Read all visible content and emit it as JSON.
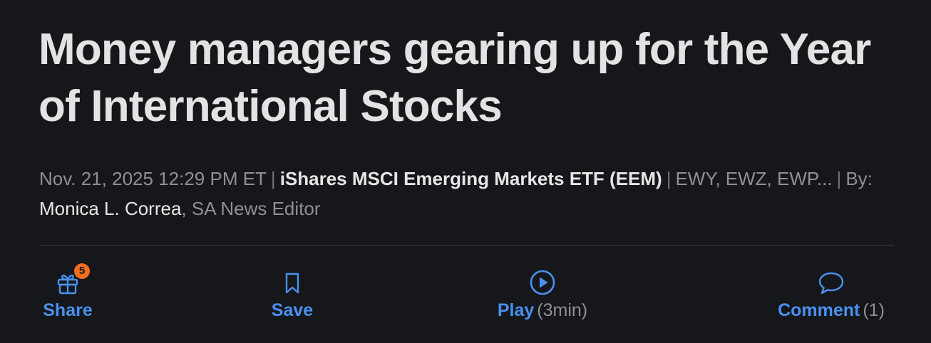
{
  "article": {
    "headline": "Money managers gearing up for the Year of International Stocks",
    "date": "Nov. 21, 2025 12:29 PM ET",
    "primary_ticker": "iShares MSCI Emerging Markets ETF (EEM)",
    "other_tickers": "EWY, EWZ, EWP...",
    "by_label": "By:",
    "author": "Monica L. Correa",
    "author_role": ", SA News Editor",
    "separator": "|"
  },
  "actions": {
    "share": {
      "label": "Share",
      "badge": "5",
      "icon": "gift-icon"
    },
    "save": {
      "label": "Save",
      "icon": "bookmark-icon"
    },
    "play": {
      "label": "Play",
      "extra": "(3min)",
      "icon": "play-circle-icon"
    },
    "comment": {
      "label": "Comment",
      "extra": "(1)",
      "icon": "speech-bubble-icon"
    }
  },
  "colors": {
    "background": "#15171a",
    "headline": "#e3e3e3",
    "muted": "#8d9096",
    "accent": "#4a90f0",
    "badge": "#f26d1f",
    "divider": "#3a3d42"
  }
}
